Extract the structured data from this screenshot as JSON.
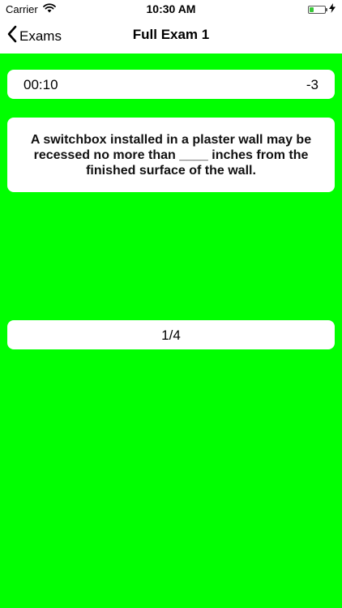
{
  "status_bar": {
    "carrier": "Carrier",
    "time": "10:30 AM",
    "battery_level": 0.3
  },
  "nav": {
    "back_label": "Exams",
    "title": "Full Exam 1"
  },
  "exam": {
    "timer": "00:10",
    "score": "-3",
    "question": "A switchbox installed in a plaster wall may be recessed no more than ____ inches from the finished surface of the wall.",
    "progress": "1/4"
  },
  "colors": {
    "background": "#00ff00",
    "card": "#ffffff"
  }
}
